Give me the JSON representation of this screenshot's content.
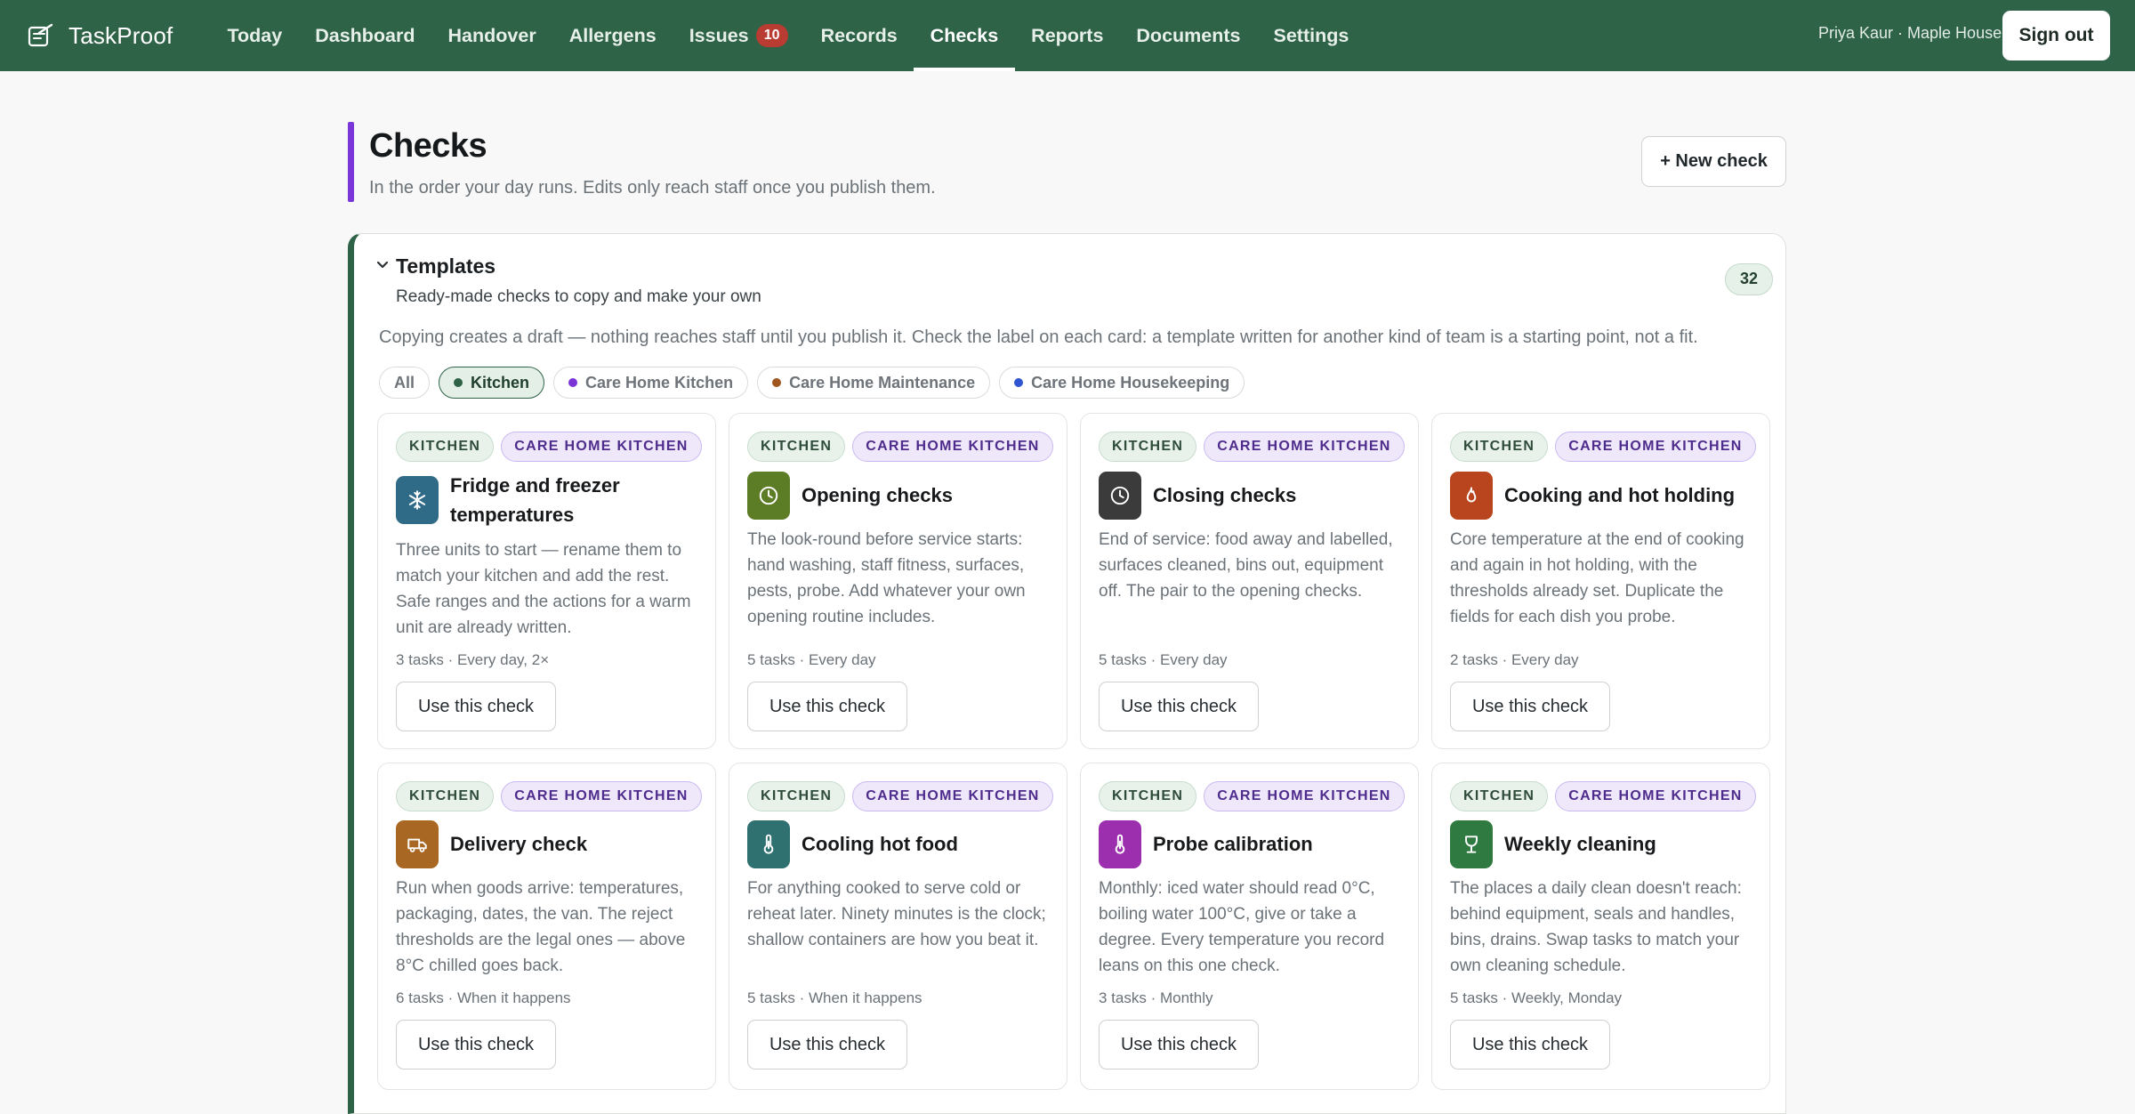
{
  "app": {
    "name": "TaskProof"
  },
  "nav": {
    "items": [
      "Today",
      "Dashboard",
      "Handover",
      "Allergens",
      "Issues",
      "Records",
      "Checks",
      "Reports",
      "Documents",
      "Settings"
    ],
    "issues_count": "10",
    "active": "Checks"
  },
  "user": {
    "info": "Priya Kaur · Maple House",
    "signout_label": "Sign out"
  },
  "page": {
    "title": "Checks",
    "subtitle": "In the order your day runs. Edits only reach staff once you publish them.",
    "new_button": "+ New check"
  },
  "templates": {
    "title": "Templates",
    "subtitle": "Ready-made checks to copy and make your own",
    "count": "32",
    "note": "Copying creates a draft — nothing reaches staff until you publish it. Check the label on each card: a template written for another kind of team is a starting point, not a fit.",
    "filters": [
      {
        "label": "All",
        "dot": ""
      },
      {
        "label": "Kitchen",
        "dot": "#2e6347"
      },
      {
        "label": "Care Home Kitchen",
        "dot": "#7b35d6"
      },
      {
        "label": "Care Home Maintenance",
        "dot": "#a0561f"
      },
      {
        "label": "Care Home Housekeeping",
        "dot": "#2f55d0"
      }
    ],
    "active_filter": "Kitchen",
    "use_label": "Use this check",
    "cards": [
      {
        "tags": [
          "KITCHEN",
          "CARE HOME KITCHEN"
        ],
        "icon": "snowflake-icon",
        "icon_color": "#2f6b86",
        "title": "Fridge and freezer temperatures",
        "desc": "Three units to start — rename them to match your kitchen and add the rest. Safe ranges and the actions for a warm unit are already written.",
        "meta": "3 tasks · Every day, 2×"
      },
      {
        "tags": [
          "KITCHEN",
          "CARE HOME KITCHEN"
        ],
        "icon": "clock-icon",
        "icon_color": "#5c7c25",
        "title": "Opening checks",
        "desc": "The look-round before service starts: hand washing, staff fitness, surfaces, pests, probe. Add whatever your own opening routine includes.",
        "meta": "5 tasks · Every day"
      },
      {
        "tags": [
          "KITCHEN",
          "CARE HOME KITCHEN"
        ],
        "icon": "clock-icon",
        "icon_color": "#3b3b3b",
        "title": "Closing checks",
        "desc": "End of service: food away and labelled, surfaces cleaned, bins out, equipment off. The pair to the opening checks.",
        "meta": "5 tasks · Every day"
      },
      {
        "tags": [
          "KITCHEN",
          "CARE HOME KITCHEN"
        ],
        "icon": "flame-icon",
        "icon_color": "#b8451d",
        "title": "Cooking and hot holding",
        "desc": "Core temperature at the end of cooking and again in hot holding, with the thresholds already set. Duplicate the fields for each dish you probe.",
        "meta": "2 tasks · Every day"
      },
      {
        "tags": [
          "KITCHEN",
          "CARE HOME KITCHEN"
        ],
        "icon": "truck-icon",
        "icon_color": "#a86722",
        "title": "Delivery check",
        "desc": "Run when goods arrive: temperatures, packaging, dates, the van. The reject thresholds are the legal ones — above 8°C chilled goes back.",
        "meta": "6 tasks · When it happens"
      },
      {
        "tags": [
          "KITCHEN",
          "CARE HOME KITCHEN"
        ],
        "icon": "thermometer-icon",
        "icon_color": "#2f7070",
        "title": "Cooling hot food",
        "desc": "For anything cooked to serve cold or reheat later. Ninety minutes is the clock; shallow containers are how you beat it.",
        "meta": "5 tasks · When it happens"
      },
      {
        "tags": [
          "KITCHEN",
          "CARE HOME KITCHEN"
        ],
        "icon": "thermometer-icon",
        "icon_color": "#9b2fae",
        "title": "Probe calibration",
        "desc": "Monthly: iced water should read 0°C, boiling water 100°C, give or take a degree. Every temperature you record leans on this one check.",
        "meta": "3 tasks · Monthly"
      },
      {
        "tags": [
          "KITCHEN",
          "CARE HOME KITCHEN"
        ],
        "icon": "cup-icon",
        "icon_color": "#2f7a40",
        "title": "Weekly cleaning",
        "desc": "The places a daily clean doesn't reach: behind equipment, seals and handles, bins, drains. Swap tasks to match your own cleaning schedule.",
        "meta": "5 tasks · Weekly, Monday"
      }
    ]
  }
}
